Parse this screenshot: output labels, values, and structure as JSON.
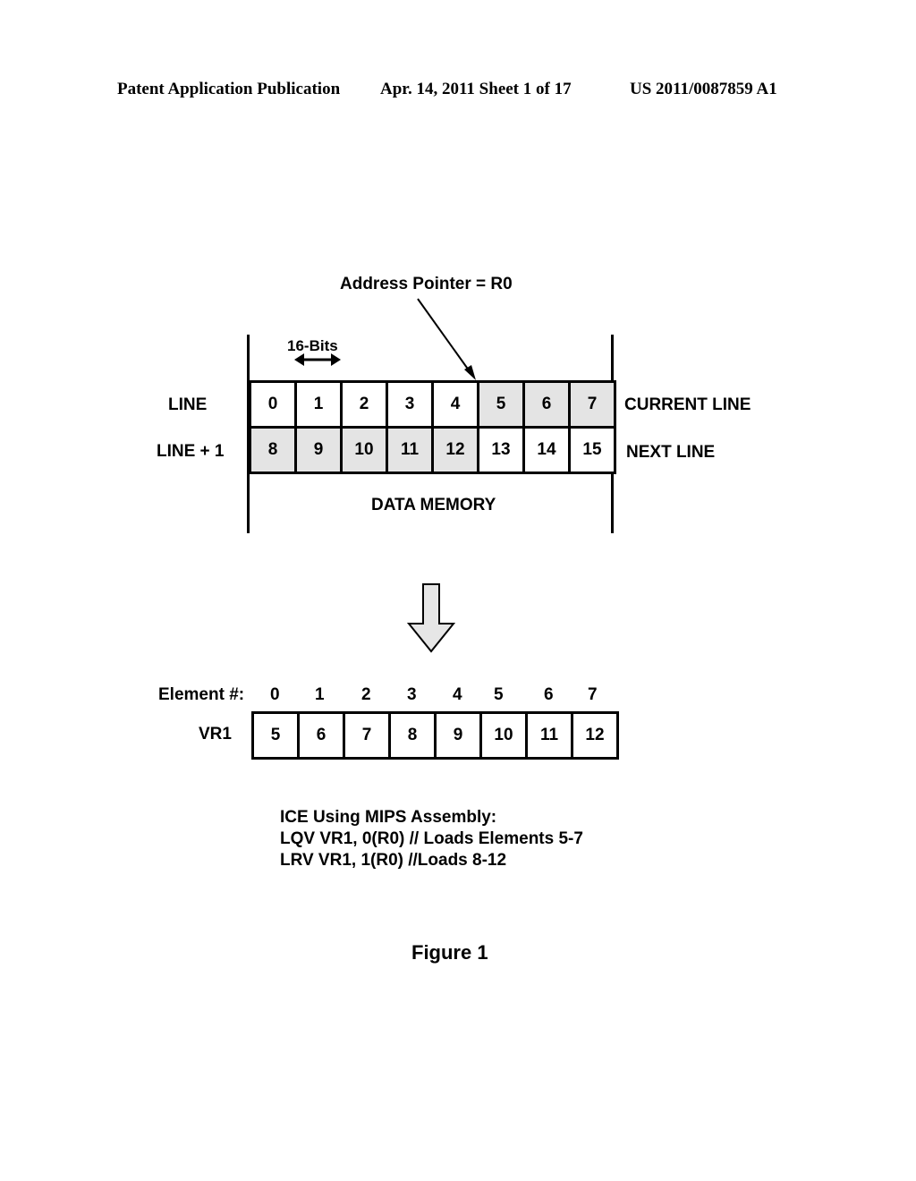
{
  "header": {
    "publication": "Patent Application Publication",
    "date_sheet": "Apr. 14, 2011  Sheet 1 of 17",
    "number": "US 2011/0087859 A1"
  },
  "diagram": {
    "pointer_label": "Address Pointer = R0",
    "width_label": "16-Bits",
    "row_labels_left": [
      "LINE",
      "LINE + 1"
    ],
    "row_labels_right": [
      "CURRENT LINE",
      "NEXT LINE"
    ],
    "memory_label": "DATA MEMORY",
    "rows": [
      {
        "cells": [
          "0",
          "1",
          "2",
          "3",
          "4",
          "5",
          "6",
          "7"
        ],
        "shaded": [
          false,
          false,
          false,
          false,
          false,
          true,
          true,
          true
        ]
      },
      {
        "cells": [
          "8",
          "9",
          "10",
          "11",
          "12",
          "13",
          "14",
          "15"
        ],
        "shaded": [
          true,
          true,
          true,
          true,
          true,
          false,
          false,
          false
        ]
      }
    ],
    "element_header_label": "Element #:",
    "element_indices": [
      "0",
      "1",
      "2",
      "3",
      "4",
      "5",
      "6",
      "7"
    ],
    "register_label": "VR1",
    "register_values": [
      "5",
      "6",
      "7",
      "8",
      "9",
      "10",
      "11",
      "12"
    ],
    "code_lines": [
      "ICE Using MIPS Assembly:",
      "LQV  VR1, 0(R0) // Loads Elements 5-7",
      "LRV  VR1, 1(R0) //Loads 8-12"
    ],
    "figure_caption": "Figure 1"
  },
  "colors": {
    "shaded_cell": "#e4e4e4",
    "arrow_fill": "#e6e6e6"
  }
}
